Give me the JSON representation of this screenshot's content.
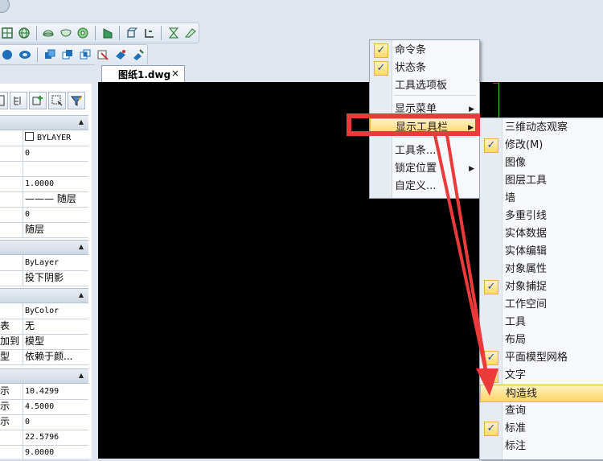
{
  "document": {
    "tab_label": "图纸1.dwg",
    "close_glyph": "×"
  },
  "properties": {
    "general": {
      "rows": [
        {
          "key": "",
          "value": "BYLAYER",
          "swatch": true
        },
        {
          "key": "",
          "value": "0"
        },
        {
          "key": "",
          "value": ""
        },
        {
          "key": "",
          "value": "1.0000"
        },
        {
          "key": "",
          "value": "——— 随层"
        },
        {
          "key": "",
          "value": "0"
        },
        {
          "key": "",
          "value": "随层"
        }
      ]
    },
    "display": {
      "rows": [
        {
          "key": "",
          "value": "ByLayer"
        },
        {
          "key": "",
          "value": "投下阴影"
        }
      ]
    },
    "plot": {
      "rows": [
        {
          "key": "",
          "value": "ByColor"
        },
        {
          "key": "表",
          "value": "无"
        },
        {
          "key": "加到",
          "value": "模型"
        },
        {
          "key": "型",
          "value": "依赖于颜..."
        }
      ]
    },
    "view": {
      "rows": [
        {
          "key": "示",
          "value": "10.4299"
        },
        {
          "key": "示",
          "value": "4.5000"
        },
        {
          "key": "示",
          "value": "0"
        },
        {
          "key": "",
          "value": "22.5796"
        },
        {
          "key": "",
          "value": "9.0000"
        }
      ]
    }
  },
  "context_menu": {
    "items": [
      {
        "label": "命令条",
        "checked": true
      },
      {
        "label": "状态条",
        "checked": true
      },
      {
        "label": "工具选项板",
        "checked": false
      },
      {
        "label": "显示菜单",
        "checked": false,
        "submenu": true
      },
      {
        "label": "显示工具栏",
        "checked": false,
        "submenu": true,
        "highlighted": true
      },
      {
        "label": "工具条...",
        "checked": false
      },
      {
        "label": "锁定位置",
        "checked": false,
        "submenu": true
      },
      {
        "label": "自定义...",
        "checked": false
      }
    ]
  },
  "toolbar_submenu": {
    "items": [
      {
        "label": "三维动态观察",
        "checked": false
      },
      {
        "label": "修改(M)",
        "checked": true
      },
      {
        "label": "图像",
        "checked": false
      },
      {
        "label": "图层工具",
        "checked": false
      },
      {
        "label": "墙",
        "checked": false
      },
      {
        "label": "多重引线",
        "checked": false
      },
      {
        "label": "实体数据",
        "checked": false
      },
      {
        "label": "实体编辑",
        "checked": false
      },
      {
        "label": "对象属性",
        "checked": false
      },
      {
        "label": "对象捕捉",
        "checked": true
      },
      {
        "label": "工作空间",
        "checked": false
      },
      {
        "label": "工具",
        "checked": false
      },
      {
        "label": "布局",
        "checked": false
      },
      {
        "label": "平面模型网格",
        "checked": true
      },
      {
        "label": "文字",
        "checked": true
      },
      {
        "label": "构造线",
        "checked": false,
        "highlighted": true
      },
      {
        "label": "查询",
        "checked": false
      },
      {
        "label": "标准",
        "checked": true
      },
      {
        "label": "标注",
        "checked": false
      }
    ]
  },
  "glyphs": {
    "check": "✓",
    "submenu_arrow": "▶",
    "collapse": "▲"
  },
  "colors": {
    "highlight_fill": "#ffd565",
    "annotation_red": "#ea3a3a",
    "canvas": "#000000"
  }
}
